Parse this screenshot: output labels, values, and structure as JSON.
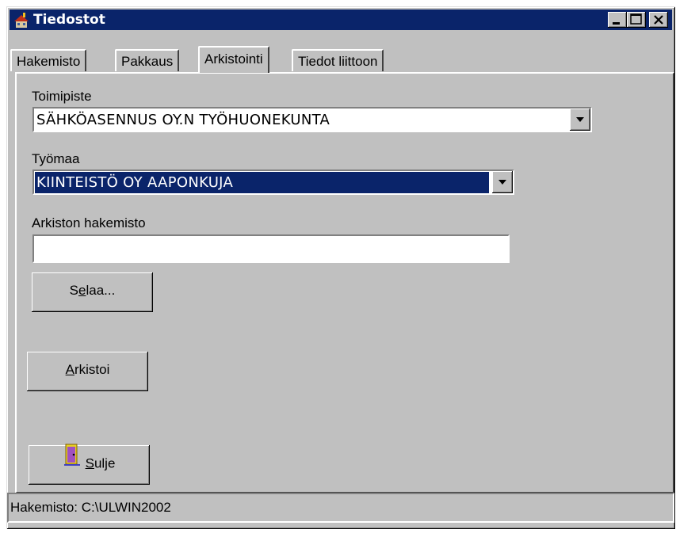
{
  "window": {
    "title": "Tiedostot",
    "icon": "building-icon"
  },
  "tabs": [
    {
      "label": "Hakemisto",
      "active": false
    },
    {
      "label": "Pakkaus",
      "active": false
    },
    {
      "label": "Arkistointi",
      "active": true
    },
    {
      "label": "Tiedot liittoon",
      "active": false
    }
  ],
  "form": {
    "office_label": "Toimipiste",
    "office_value": "SÄHKÖASENNUS OY.N TYÖHUONEKUNTA",
    "site_label": "Työmaa",
    "site_value": "KIINTEISTÖ OY AAPONKUJA",
    "archive_dir_label": "Arkiston hakemisto",
    "archive_dir_value": ""
  },
  "buttons": {
    "browse_label": "Selaa...",
    "browse_access_key": "e",
    "archive_label": "Arkistoi",
    "archive_access_key": "A",
    "close_label": "Sulje",
    "close_access_key": "S",
    "close_icon": "door-exit-icon"
  },
  "status": {
    "text": "Hakemisto: C:\\ULWIN2002"
  }
}
